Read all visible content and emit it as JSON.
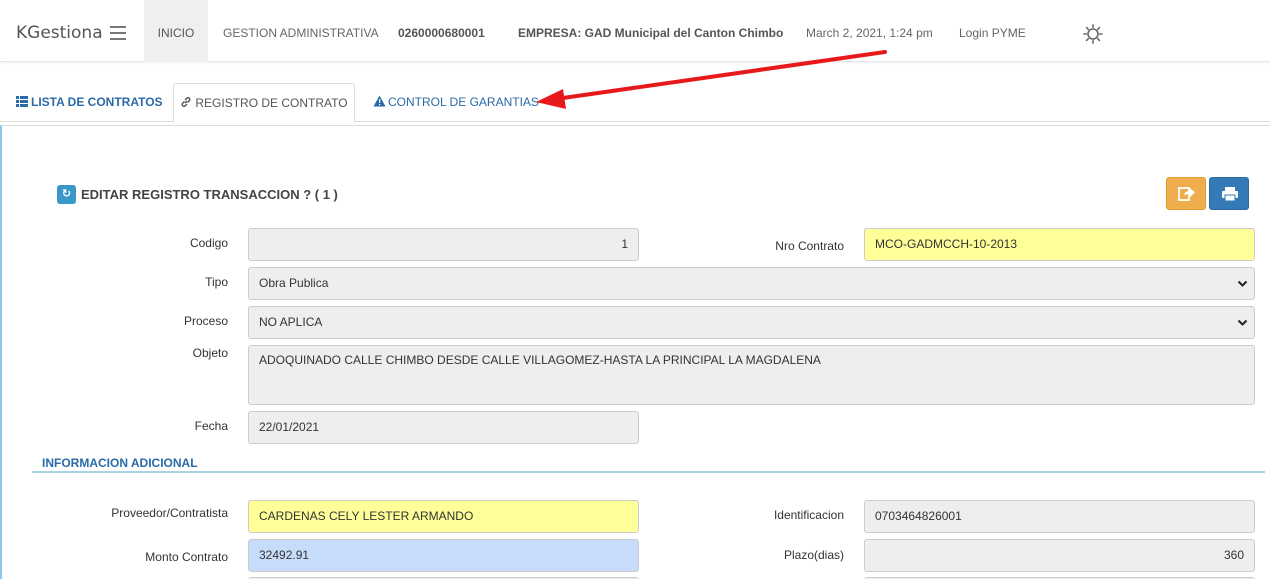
{
  "nav": {
    "brand": "KGestiona",
    "inicio": "INICIO",
    "gestion": "GESTION ADMINISTRATIVA",
    "ruc": "0260000680001",
    "empresa": "EMPRESA: GAD Municipal del Canton Chimbo",
    "date": "March 2, 2021, 1:24 pm",
    "login": "Login PYME"
  },
  "tabs": {
    "lista": "LISTA DE CONTRATOS",
    "registro": "REGISTRO DE CONTRATO",
    "control": "CONTROL DE GARANTIAS"
  },
  "form": {
    "title": "EDITAR REGISTRO TRANSACCION ? ( 1 )",
    "codigo_label": "Codigo",
    "codigo_value": "1",
    "nro_contrato_label": "Nro Contrato",
    "nro_contrato_value": "MCO-GADMCCH-10-2013",
    "tipo_label": "Tipo",
    "tipo_value": "Obra Publica",
    "proceso_label": "Proceso",
    "proceso_value": "NO APLICA",
    "objeto_label": "Objeto",
    "objeto_value": "ADOQUINADO CALLE  CHIMBO DESDE CALLE VILLAGOMEZ-HASTA LA PRINCIPAL LA MAGDALENA",
    "fecha_label": "Fecha",
    "fecha_value": "22/01/2021"
  },
  "adicional": {
    "header": "INFORMACION ADICIONAL",
    "proveedor_label": "Proveedor/Contratista",
    "proveedor_value": "CARDENAS CELY LESTER ARMANDO",
    "identificacion_label": "Identificacion",
    "identificacion_value": "0703464826001",
    "monto_label": "Monto Contrato",
    "monto_value": "32492.91",
    "plazo_label": "Plazo(dias)",
    "plazo_value": "360"
  },
  "colors": {
    "accent": "#2a6aa8",
    "save_button": "#f0ad4e",
    "print_button": "#337ab7",
    "highlight_yellow": "#ffff99",
    "highlight_blue": "#c7dcfb",
    "annotation_arrow": "#e8191b"
  },
  "icons": {
    "menu": "hamburger-icon",
    "settings": "sun-gear-icon",
    "lista": "list-icon",
    "registro": "link-icon",
    "control": "warning-icon",
    "save": "share-arrow-icon",
    "print": "print-icon"
  }
}
